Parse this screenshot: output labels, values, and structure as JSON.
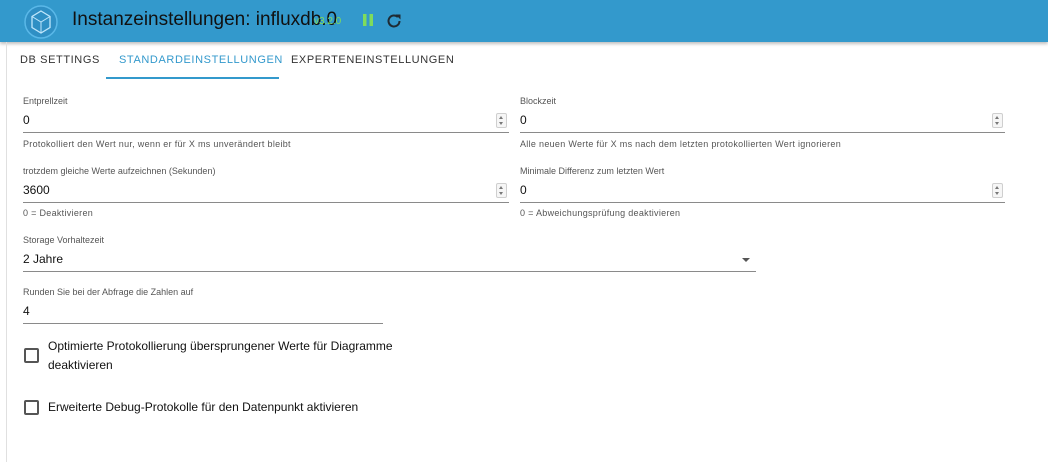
{
  "header": {
    "title": "Instanzeinstellungen: influxdb.0",
    "version": "v3.2.0",
    "logo_icon": "hexagon-logo-icon",
    "pause_icon": "pause-icon",
    "reload_icon": "reload-icon",
    "accent": "#3399cc",
    "version_color": "#7fdc5c"
  },
  "tabs": [
    {
      "label": "DB SETTINGS",
      "active": false
    },
    {
      "label": "STANDARDEINSTELLUNGEN",
      "active": true
    },
    {
      "label": "EXPERTENEINSTELLUNGEN",
      "active": false
    }
  ],
  "fields": {
    "debounce": {
      "label": "Entprellzeit",
      "value": "0",
      "helper": "Protokolliert den Wert nur, wenn er für X ms unverändert bleibt"
    },
    "blocktime": {
      "label": "Blockzeit",
      "value": "0",
      "helper": "Alle neuen Werte für X ms nach dem letzten protokollierten Wert ignorieren"
    },
    "same_values": {
      "label": "trotzdem gleiche Werte aufzeichnen (Sekunden)",
      "value": "3600",
      "helper": "0 = Deaktivieren"
    },
    "min_diff": {
      "label": "Minimale Differenz zum letzten Wert",
      "value": "0",
      "helper": "0 = Abweichungsprüfung deaktivieren"
    },
    "retention": {
      "label": "Storage Vorhaltezeit",
      "value": "2 Jahre"
    },
    "round": {
      "label": "Runden Sie bei der Abfrage die Zahlen auf",
      "value": "4"
    }
  },
  "checkboxes": {
    "optimized_logging": {
      "line1": "Optimierte Protokollierung übersprungener Werte für Diagramme",
      "line2": "deaktivieren",
      "checked": false
    },
    "debug_logs": {
      "label": "Erweiterte Debug-Protokolle für den Datenpunkt aktivieren",
      "checked": false
    }
  }
}
